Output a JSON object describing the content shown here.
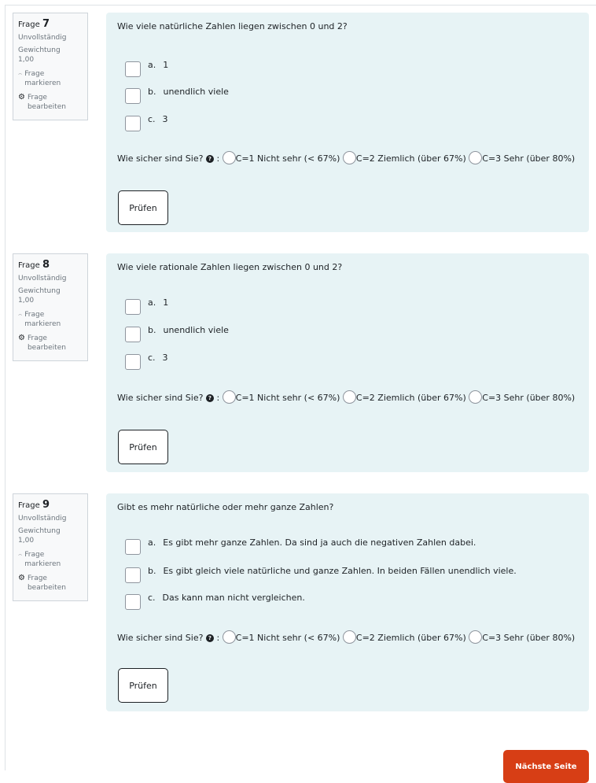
{
  "questions": [
    {
      "label": "Frage",
      "number": "7",
      "status": "Unvollständig",
      "weight_label": "Gewichtung",
      "weight_value": "1,00",
      "flag_label": "Frage markieren",
      "edit_label": "Frage bearbeiten",
      "text": "Wie viele natürliche Zahlen liegen zwischen 0 und 2?",
      "answers": [
        {
          "letter": "a.",
          "text": "1"
        },
        {
          "letter": "b.",
          "text": "unendlich viele"
        },
        {
          "letter": "c.",
          "text": "3"
        }
      ],
      "certainty_prompt": "Wie sicher sind Sie?",
      "certainty_colon": ":",
      "certainty_options": [
        "C=1 Nicht sehr (< 67%)",
        "C=2 Ziemlich (über 67%)",
        "C=3 Sehr (über 80%)"
      ],
      "check_label": "Prüfen"
    },
    {
      "label": "Frage",
      "number": "8",
      "status": "Unvollständig",
      "weight_label": "Gewichtung",
      "weight_value": "1,00",
      "flag_label": "Frage markieren",
      "edit_label": "Frage bearbeiten",
      "text": "Wie viele rationale Zahlen liegen zwischen 0 und 2?",
      "answers": [
        {
          "letter": "a.",
          "text": "1"
        },
        {
          "letter": "b.",
          "text": "unendlich viele"
        },
        {
          "letter": "c.",
          "text": "3"
        }
      ],
      "certainty_prompt": "Wie sicher sind Sie?",
      "certainty_colon": ":",
      "certainty_options": [
        "C=1 Nicht sehr (< 67%)",
        "C=2 Ziemlich (über 67%)",
        "C=3 Sehr (über 80%)"
      ],
      "check_label": "Prüfen"
    },
    {
      "label": "Frage",
      "number": "9",
      "status": "Unvollständig",
      "weight_label": "Gewichtung",
      "weight_value": "1,00",
      "flag_label": "Frage markieren",
      "edit_label": "Frage bearbeiten",
      "text": "Gibt es mehr natürliche oder mehr ganze Zahlen?",
      "answers": [
        {
          "letter": "a.",
          "text": "Es gibt mehr ganze Zahlen. Da sind ja auch die negativen Zahlen dabei."
        },
        {
          "letter": "b.",
          "text": "Es gibt gleich viele natürliche und ganze Zahlen. In beiden Fällen unendlich viele."
        },
        {
          "letter": "c.",
          "text": "Das kann man nicht vergleichen."
        }
      ],
      "certainty_prompt": "Wie sicher sind Sie?",
      "certainty_colon": ":",
      "certainty_options": [
        "C=1 Nicht sehr (< 67%)",
        "C=2 Ziemlich (über 67%)",
        "C=3 Sehr (über 80%)"
      ],
      "check_label": "Prüfen"
    }
  ],
  "icons": {
    "flag": "flag-icon",
    "edit": "gear-icon",
    "help": "question-circle-icon"
  },
  "colors": {
    "content_bg": "#e7f3f5",
    "next_button": "#d73e15"
  },
  "next_button_label": "Nächste Seite"
}
